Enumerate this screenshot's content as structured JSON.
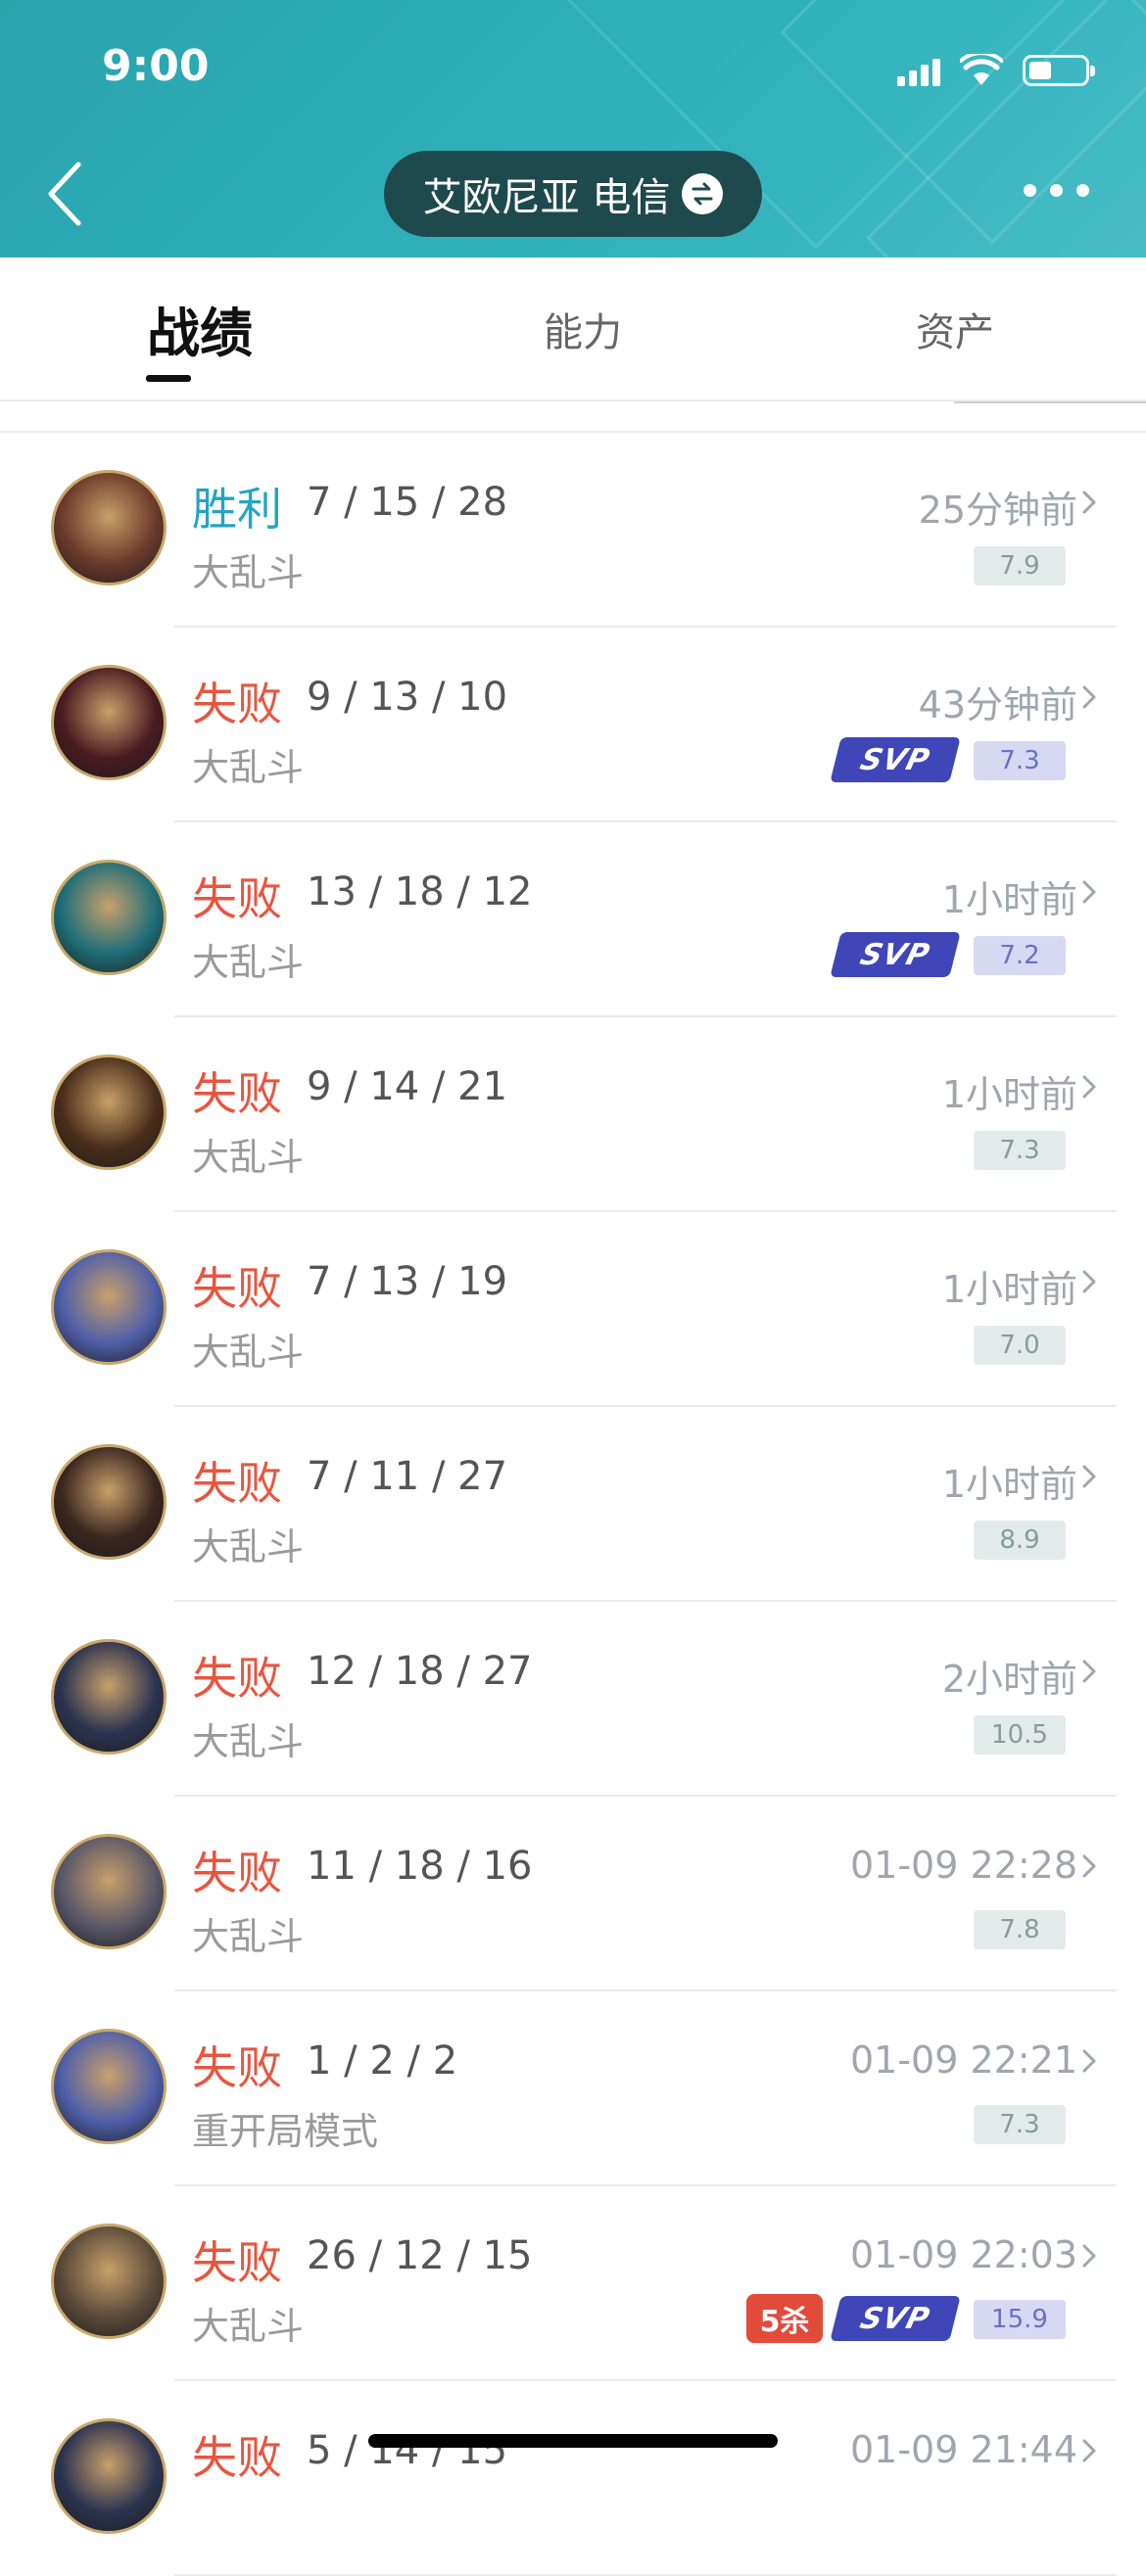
{
  "status_bar": {
    "time": "9:00"
  },
  "header": {
    "server": "艾欧尼亚  电信"
  },
  "tabs": [
    {
      "label": "战绩",
      "active": true
    },
    {
      "label": "能力",
      "active": false
    },
    {
      "label": "资产",
      "active": false
    }
  ],
  "matches": [
    {
      "result": "胜利",
      "win": true,
      "kda": "7 / 15 / 28",
      "mode": "大乱斗",
      "time": "25分钟前",
      "score": "7.9",
      "svp": false,
      "penta": false,
      "avatar_color": "#6b3a2a"
    },
    {
      "result": "失败",
      "win": false,
      "kda": "9 / 13 / 10",
      "mode": "大乱斗",
      "time": "43分钟前",
      "score": "7.3",
      "svp": true,
      "penta": false,
      "avatar_color": "#4a1a22"
    },
    {
      "result": "失败",
      "win": false,
      "kda": "13 / 18 / 12",
      "mode": "大乱斗",
      "time": "1小时前",
      "score": "7.2",
      "svp": true,
      "penta": false,
      "avatar_color": "#1f6e78"
    },
    {
      "result": "失败",
      "win": false,
      "kda": "9 / 14 / 21",
      "mode": "大乱斗",
      "time": "1小时前",
      "score": "7.3",
      "svp": false,
      "penta": false,
      "avatar_color": "#4a2e1a"
    },
    {
      "result": "失败",
      "win": false,
      "kda": "7 / 13 / 19",
      "mode": "大乱斗",
      "time": "1小时前",
      "score": "7.0",
      "svp": false,
      "penta": false,
      "avatar_color": "#4f5fa8"
    },
    {
      "result": "失败",
      "win": false,
      "kda": "7 / 11 / 27",
      "mode": "大乱斗",
      "time": "1小时前",
      "score": "8.9",
      "svp": false,
      "penta": false,
      "avatar_color": "#3a2620"
    },
    {
      "result": "失败",
      "win": false,
      "kda": "12 / 18 / 27",
      "mode": "大乱斗",
      "time": "2小时前",
      "score": "10.5",
      "svp": false,
      "penta": false,
      "avatar_color": "#2c3450"
    },
    {
      "result": "失败",
      "win": false,
      "kda": "11 / 18 / 16",
      "mode": "大乱斗",
      "time": "01-09 22:28",
      "score": "7.8",
      "svp": false,
      "penta": false,
      "avatar_color": "#5a5868"
    },
    {
      "result": "失败",
      "win": false,
      "kda": "1 / 2 / 2",
      "mode": "重开局模式",
      "time": "01-09 22:21",
      "score": "7.3",
      "svp": false,
      "penta": false,
      "avatar_color": "#4f5fa8"
    },
    {
      "result": "失败",
      "win": false,
      "kda": "26 / 12 / 15",
      "mode": "大乱斗",
      "time": "01-09 22:03",
      "score": "15.9",
      "svp": true,
      "penta": true,
      "avatar_color": "#5a4a3a"
    },
    {
      "result": "失败",
      "win": false,
      "kda": "5 / 14 / 15",
      "mode": "",
      "time": "01-09 21:44",
      "score": "",
      "svp": false,
      "penta": false,
      "avatar_color": "#2c3450"
    }
  ],
  "badges": {
    "svp": "SVP",
    "penta": "5杀"
  },
  "colors": {
    "header": "#2fb1bb",
    "win": "#23a4c4",
    "loss": "#e8553f",
    "svp": "#3f46b8"
  }
}
